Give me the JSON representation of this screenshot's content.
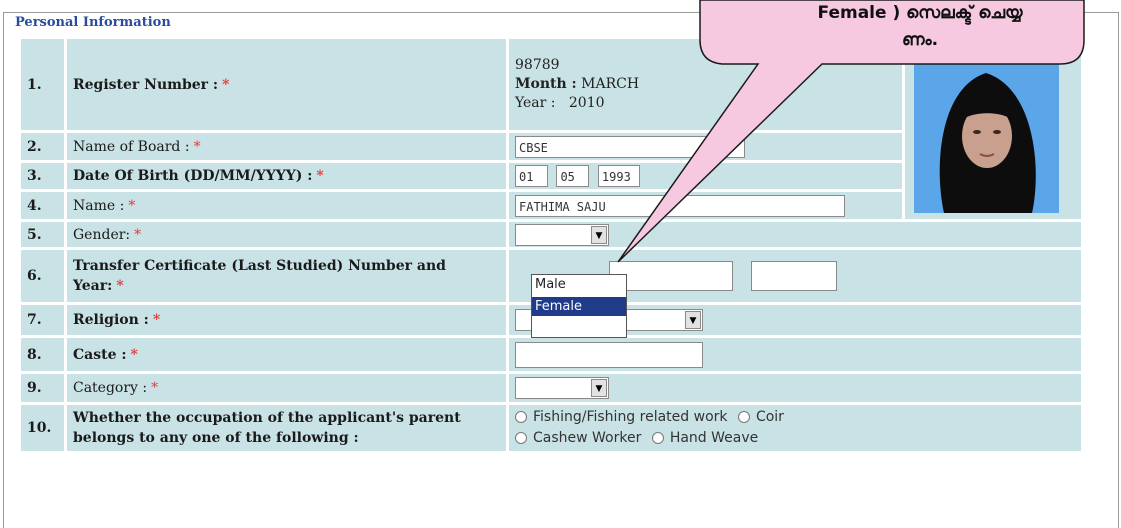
{
  "section": {
    "legend": "Personal Information"
  },
  "rows": [
    {
      "num": "1.",
      "label": "Register Number :",
      "required": true,
      "register_number": "98789",
      "month_label": "Month :",
      "month": "MARCH",
      "year_label": "Year :",
      "year": "2010"
    },
    {
      "num": "2.",
      "label": "Name of Board :",
      "required": true,
      "value": "CBSE"
    },
    {
      "num": "3.",
      "label": "Date Of Birth (DD/MM/YYYY) :",
      "required": true,
      "dd": "01",
      "mm": "05",
      "yyyy": "1993"
    },
    {
      "num": "4.",
      "label": "Name :",
      "required": true,
      "value": "FATHIMA SAJU"
    },
    {
      "num": "5.",
      "label": "Gender:",
      "required": true,
      "value": ""
    },
    {
      "num": "6.",
      "label": "Transfer Certificate (Last Studied) Number and Year:",
      "required": true,
      "tc_number": "",
      "tc_year": ""
    },
    {
      "num": "7.",
      "label": "Religion :",
      "required": true,
      "value": ""
    },
    {
      "num": "8.",
      "label": "Caste :",
      "required": true,
      "value": ""
    },
    {
      "num": "9.",
      "label": "Category :",
      "required": true,
      "value": ""
    },
    {
      "num": "10.",
      "label": "Whether the occupation of the applicant's parent belongs to any one of the following :",
      "required": false
    }
  ],
  "occupation_options": [
    "Fishing/Fishing related work",
    "Coir",
    "Cashew Worker",
    "Hand Weave"
  ],
  "gender_dropdown": {
    "options": [
      "Male",
      "Female"
    ],
    "highlighted": "Female"
  },
  "required_marker": "*",
  "callout": {
    "line1": "Female ) സെലക്ട് ചെയ്യ",
    "line2": "ണം."
  },
  "colors": {
    "row_bg": "#c9e2e6",
    "legend": "#2a4c9e",
    "required": "#e63a3a",
    "highlight": "#1f3b8a"
  }
}
